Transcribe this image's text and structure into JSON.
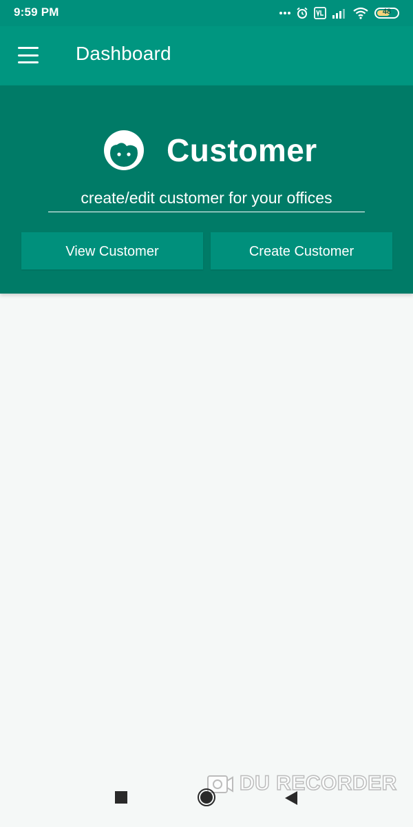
{
  "status_bar": {
    "time": "9:59 PM",
    "battery_level": "48",
    "icons": [
      "dots-icon",
      "alarm-icon",
      "volte-icon",
      "signal-icon",
      "wifi-icon",
      "battery-icon"
    ]
  },
  "app_bar": {
    "title": "Dashboard",
    "menu_icon": "hamburger-menu-icon"
  },
  "customer_card": {
    "icon": "face-icon",
    "title": "Customer",
    "subtitle": "create/edit customer for your offices",
    "buttons": {
      "view_label": "View Customer",
      "create_label": "Create Customer"
    }
  },
  "navigation_bar": {
    "icons": [
      "recents-square-icon",
      "home-circle-icon",
      "back-triangle-icon"
    ]
  },
  "watermark": {
    "text": "DU RECORDER"
  },
  "colors": {
    "status_bar": "#00907c",
    "app_bar": "#009680",
    "card_background": "#007b67",
    "button_background": "#00907c",
    "page_background": "#f5f8f7"
  }
}
